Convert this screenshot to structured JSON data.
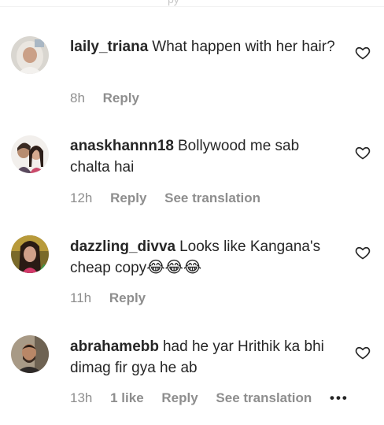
{
  "top_strip": {
    "text": "py"
  },
  "comments": [
    {
      "username": "laily_triana",
      "text": "What happen with her hair?",
      "time": "8h",
      "reply": "Reply"
    },
    {
      "username": "anaskhannn18",
      "text": "Bollywood me sab chalta hai",
      "time": "12h",
      "reply": "Reply",
      "see_translation": "See translation"
    },
    {
      "username": "dazzling_divva",
      "text": "Looks like Kangana's cheap copy",
      "emoji": "😂😂😂",
      "time": "11h",
      "reply": "Reply"
    },
    {
      "username": "abrahamebb",
      "text": "had he yar Hrithik ka bhi dimag fir gya he ab",
      "time": "13h",
      "likes": "1 like",
      "reply": "Reply",
      "see_translation": "See translation",
      "more": "•••"
    }
  ],
  "icons": {
    "like": "heart-outline-icon",
    "more": "more-options-icon"
  },
  "colors": {
    "text": "#262626",
    "secondary": "#8e8e8e"
  }
}
